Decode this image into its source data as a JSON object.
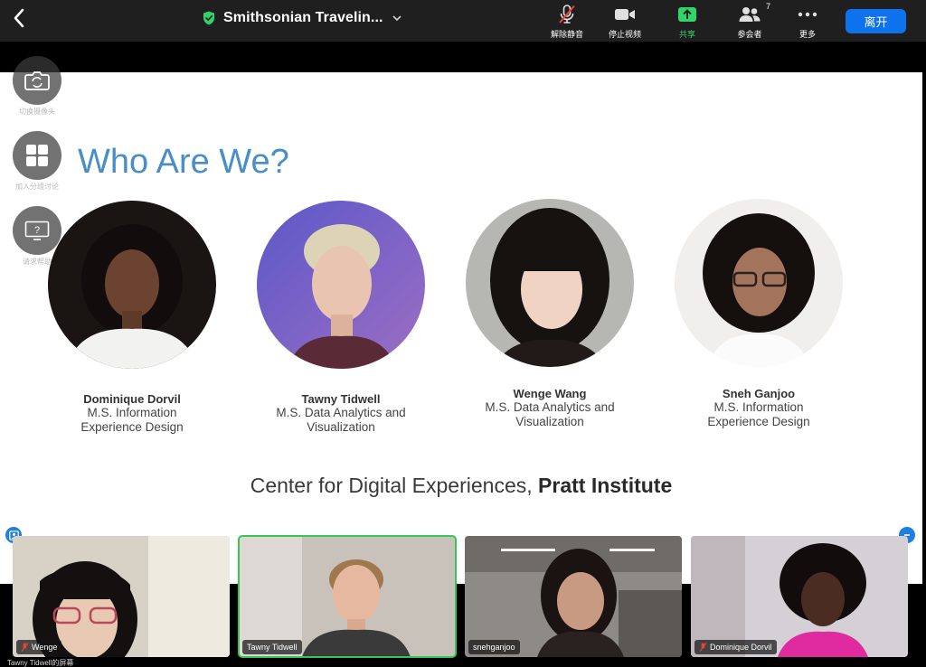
{
  "toolbar": {
    "meeting_title": "Smithsonian Travelin...",
    "buttons": [
      {
        "id": "unmute",
        "label": "解除静音"
      },
      {
        "id": "stop-video",
        "label": "停止视频"
      },
      {
        "id": "share",
        "label": "共享",
        "color": "#2fd46a"
      },
      {
        "id": "participants",
        "label": "参会者",
        "count": "7"
      },
      {
        "id": "more",
        "label": "更多"
      }
    ],
    "leave_label": "离开",
    "leave_color": "#0e72ed"
  },
  "side_controls": [
    {
      "label": "切换摄像头",
      "icon": "switch-camera-icon"
    },
    {
      "label": "加入分组讨论",
      "icon": "breakout-rooms-icon"
    },
    {
      "label": "请求帮助",
      "icon": "ask-for-help-icon"
    }
  ],
  "slide": {
    "title": "Who Are We?",
    "title_color": "#4a8ec8",
    "people": [
      {
        "name": "Dominique Dorvil",
        "program_line1": "M.S. Information",
        "program_line2": "Experience Design"
      },
      {
        "name": "Tawny Tidwell",
        "program_line1": "M.S. Data Analytics and",
        "program_line2": "Visualization"
      },
      {
        "name": "Wenge Wang",
        "program_line1": "M.S. Data Analytics and",
        "program_line2": "Visualization"
      },
      {
        "name": "Sneh Ganjoo",
        "program_line1": "M.S. Information",
        "program_line2": "Experience Design"
      }
    ],
    "footer_regular": "Center for Digital Experiences, ",
    "footer_bold": "Pratt Institute"
  },
  "video_tiles": [
    {
      "name": "Wenge",
      "muted": true
    },
    {
      "name": "Tawny Tidwell",
      "muted": false,
      "active_speaker": true
    },
    {
      "name": "snehganjoo",
      "muted": false
    },
    {
      "name": "Dominique Dorvil",
      "muted": true
    }
  ],
  "share_caption": "Tawny Tidwell的屏幕"
}
